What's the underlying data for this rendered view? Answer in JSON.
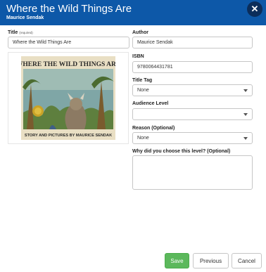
{
  "dialog": {
    "title": "Where the Wild Things Are",
    "subtitle": "Maurice Sendak",
    "close_glyph": "✕"
  },
  "form": {
    "title_label": "Title",
    "title_required": "(required)",
    "title_value": "Where the Wild Things Are",
    "author_label": "Author",
    "author_value": "Maurice Sendak",
    "isbn_label": "ISBN",
    "isbn_value": "9780064431781",
    "title_tag_label": "Title Tag",
    "title_tag_value": "None",
    "audience_label": "Audience Level",
    "audience_value": "",
    "reason_label": "Reason (Optional)",
    "reason_value": "None",
    "why_label": "Why did you choose this level? (Optional)",
    "why_value": ""
  },
  "cover": {
    "title_text": "WHERE THE WILD THINGS ARE",
    "credit_text": "STORY AND PICTURES BY MAURICE SENDAK",
    "background_color": "#e9dfc4",
    "title_color": "#2a2a2a"
  },
  "buttons": {
    "save": "Save",
    "previous": "Previous",
    "cancel": "Cancel"
  },
  "colors": {
    "header": "#0d58a8",
    "save": "#5cb85c"
  }
}
